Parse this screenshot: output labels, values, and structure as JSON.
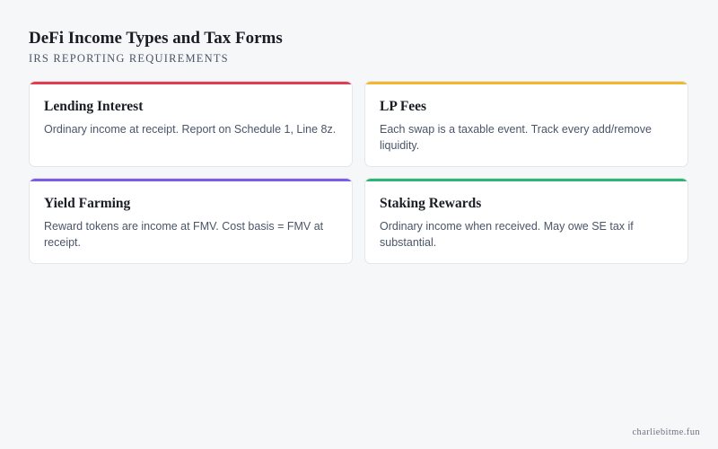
{
  "header": {
    "title": "DeFi Income Types and Tax Forms",
    "subtitle": "IRS Reporting Requirements"
  },
  "cards": [
    {
      "title": "Lending Interest",
      "description": "Ordinary income at receipt. Report on Schedule 1, Line 8z.",
      "accent": "#e03e4e"
    },
    {
      "title": "LP Fees",
      "description": "Each swap is a taxable event. Track every add/remove liquidity.",
      "accent": "#f1b82d"
    },
    {
      "title": "Yield Farming",
      "description": "Reward tokens are income at FMV. Cost basis = FMV at receipt.",
      "accent": "#7c5ce6"
    },
    {
      "title": "Staking Rewards",
      "description": "Ordinary income when received. May owe SE tax if substantial.",
      "accent": "#2bb673"
    }
  ],
  "footer": {
    "credit": "charliebitme.fun"
  }
}
